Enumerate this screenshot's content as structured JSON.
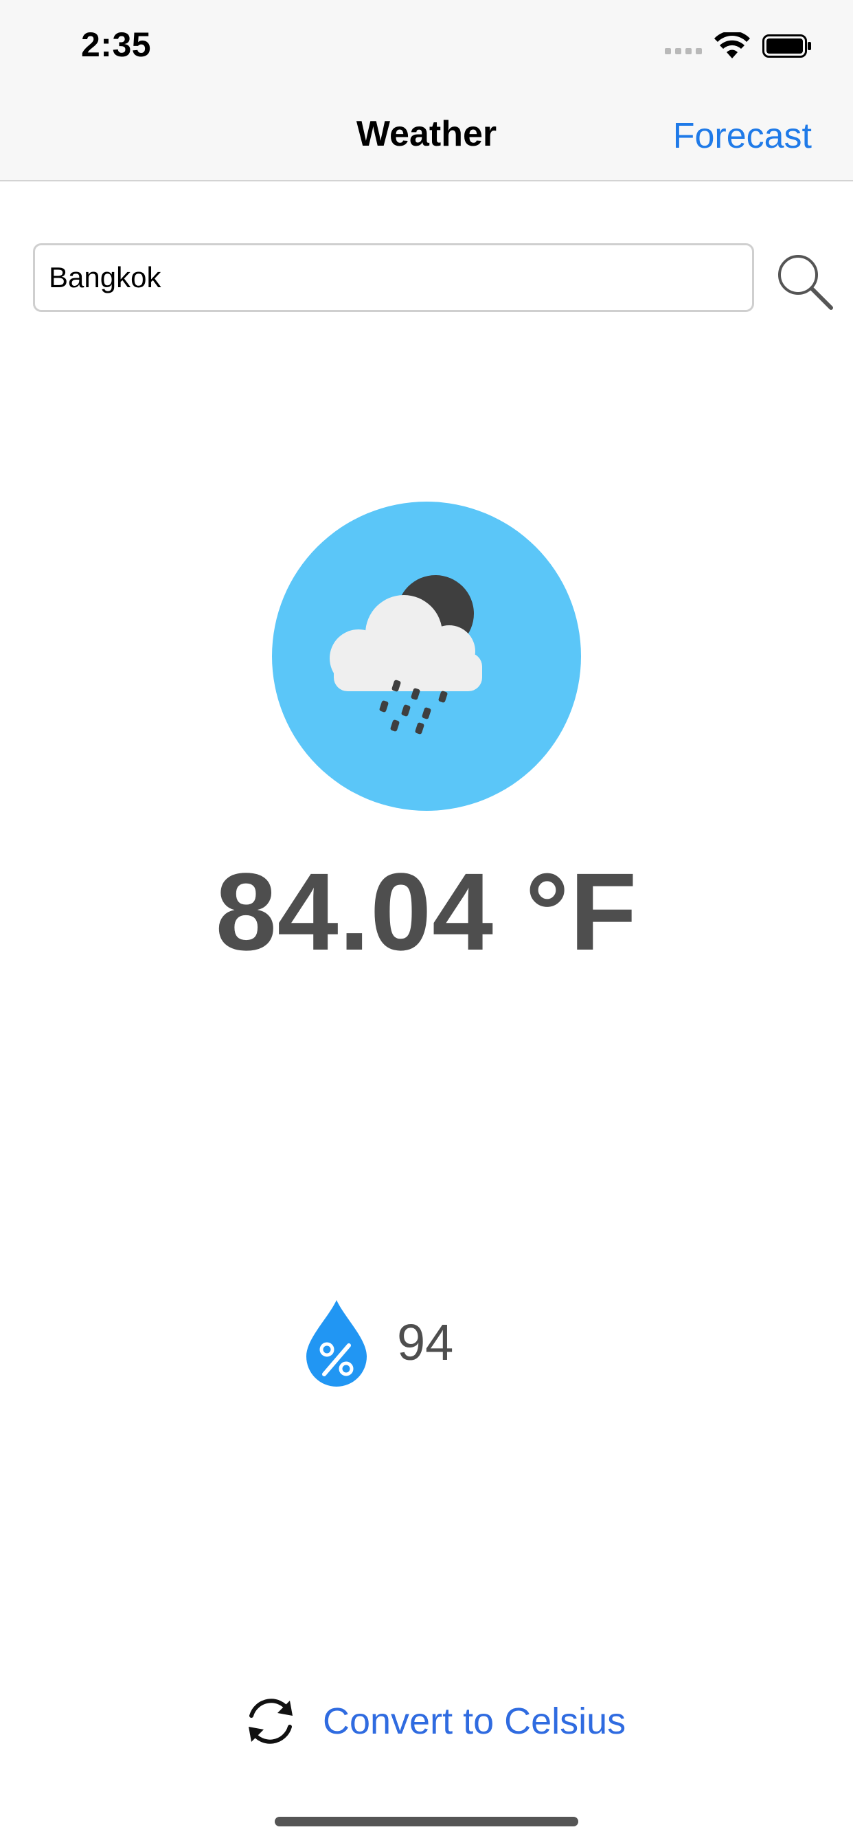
{
  "status_bar": {
    "time": "2:35",
    "icons": [
      "signal-dots-icon",
      "wifi-icon",
      "battery-icon"
    ]
  },
  "nav": {
    "title": "Weather",
    "right_label": "Forecast"
  },
  "search": {
    "value": "Bangkok",
    "icon": "magnifying-glass-icon"
  },
  "weather": {
    "condition_icon": "cloud-moon-rain-icon",
    "temperature": "84.04 °F",
    "humidity": "94",
    "humidity_icon": "humidity-drop-icon"
  },
  "convert": {
    "label": "Convert to Celsius",
    "icon": "refresh-arrows-icon"
  },
  "colors": {
    "accent": "#1f7ae8",
    "weather_circle": "#5bc6f8",
    "text_dark": "#4e4e4e",
    "humidity_drop": "#2196f3",
    "convert_link": "#2f6be0"
  }
}
